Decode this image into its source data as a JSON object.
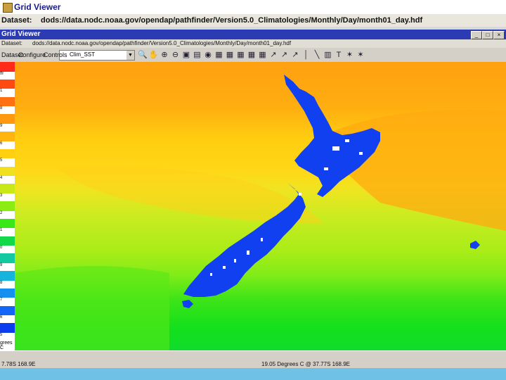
{
  "outer": {
    "title": "Grid Viewer",
    "dataset_label": "Dataset:",
    "dataset_path": "dods://data.nodc.noaa.gov/opendap/pathfinder/Version5.0_Climatologies/Monthly/Day/month01_day.hdf"
  },
  "inner": {
    "title": "Grid Viewer",
    "dataset_label": "Dataset:",
    "dataset_path": "dods://data.nodc.noaa.gov/opendap/pathfinder/Version5.0_Climatologies/Monthly/Day/month01_day.hdf"
  },
  "toolbar": {
    "menus": [
      "Dataset",
      "Configure",
      "Controls"
    ],
    "variable": "Clim_SST",
    "icons": [
      "magnify-icon",
      "hand-icon",
      "zoom-in-icon",
      "zoom-out-icon",
      "save-icon",
      "print-icon",
      "globe-icon",
      "map-icon",
      "map-icon",
      "map-icon",
      "map-icon",
      "map-icon",
      "arrow-icon",
      "arrow-icon",
      "arrow-icon",
      "pointer-icon",
      "line-icon",
      "grid-icon",
      "text-icon",
      "marker-icon",
      "marker-icon"
    ]
  },
  "legend": {
    "ticks": [
      "ffr",
      "1",
      "8",
      "9",
      "6",
      "5",
      "4",
      "3",
      "2",
      "1",
      "0",
      "9",
      "8",
      "7",
      "6",
      "5"
    ],
    "colors": [
      "#ff2a1a",
      "#ff4a10",
      "#ff7010",
      "#ff9a10",
      "#ffb410",
      "#ffd010",
      "#f0e020",
      "#c8e818",
      "#8aec10",
      "#3ae818",
      "#12d84a",
      "#14c8a0",
      "#14b4dc",
      "#1490f0",
      "#1464f8",
      "#0c3cf0"
    ],
    "footer": "grees C"
  },
  "status": {
    "left_coord": "7.78S 168.9E",
    "value_readout": "19.05 Degrees C @ 37.77S 168.9E"
  },
  "colors": {
    "land": "#1040f0",
    "inner_title_bar": "#2b3bb4"
  }
}
